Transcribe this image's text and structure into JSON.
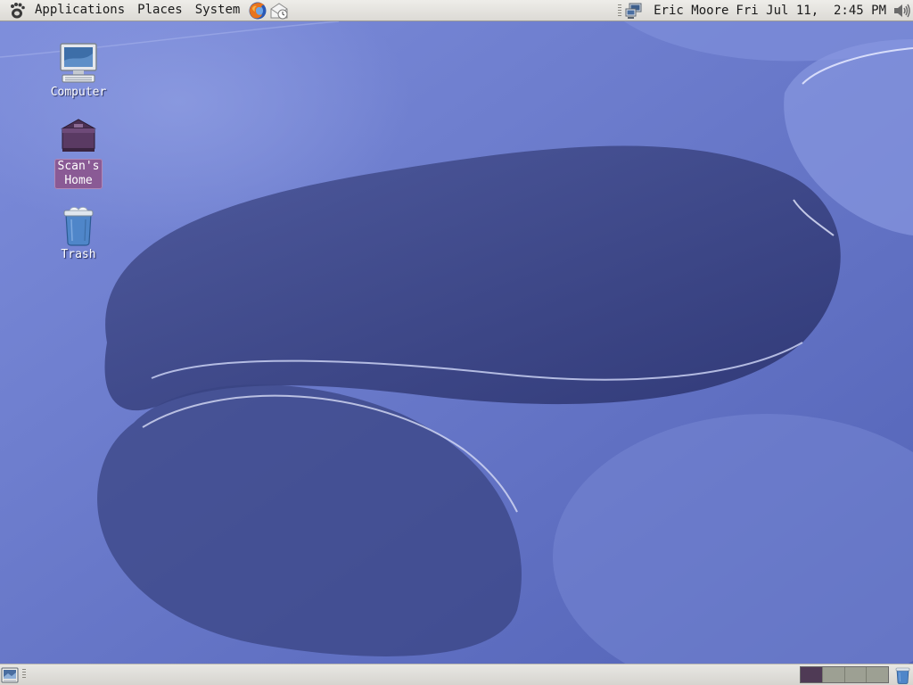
{
  "top_panel": {
    "menus": [
      "Applications",
      "Places",
      "System"
    ],
    "launchers": [
      "firefox-icon",
      "mail-clock-icon"
    ],
    "user": "Eric Moore",
    "clock": "Fri Jul 11,  2:45 PM",
    "tray_icons": [
      "network-icon",
      "volume-icon"
    ]
  },
  "desktop": {
    "icons": [
      {
        "label": "Computer",
        "icon": "computer-icon",
        "selected": false
      },
      {
        "label": "Scan's\nHome",
        "icon": "home-folder-icon",
        "selected": true
      },
      {
        "label": "Trash",
        "icon": "trash-icon",
        "selected": false
      }
    ]
  },
  "bottom_panel": {
    "workspaces": 4,
    "active_workspace": 1,
    "icons": [
      "show-desktop-icon",
      "trash-applet-icon"
    ]
  },
  "colors": {
    "panel": "#dcdad5",
    "desktop": "#5564b2",
    "selection": "#8a5a95",
    "active_workspace": "#4f3a55",
    "inactive_workspace": "#9da093"
  }
}
